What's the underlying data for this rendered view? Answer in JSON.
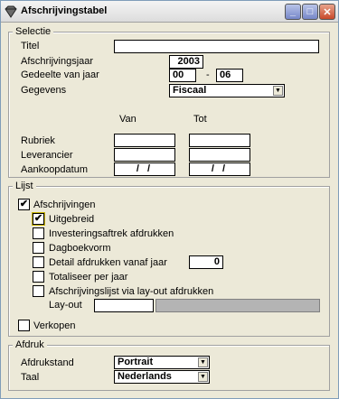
{
  "window": {
    "title": "Afschrijvingstabel",
    "buttons": {
      "minimize": "_",
      "maximize": "□",
      "close": "✕"
    }
  },
  "selectie": {
    "legend": "Selectie",
    "titel_label": "Titel",
    "titel_value": "",
    "jaar_label": "Afschrijvingsjaar",
    "jaar_value": "2003",
    "gedeelte_label": "Gedeelte van jaar",
    "gedeelte_from": "00",
    "gedeelte_sep": "-",
    "gedeelte_to": "06",
    "gegevens_label": "Gegevens",
    "gegevens_value": "Fiscaal",
    "col_van": "Van",
    "col_tot": "Tot",
    "rubriek_label": "Rubriek",
    "leverancier_label": "Leverancier",
    "aankoopdatum_label": "Aankoopdatum",
    "date_placeholder": "/ /"
  },
  "lijst": {
    "legend": "Lijst",
    "afschrijvingen": {
      "label": "Afschrijvingen",
      "checked": "✔"
    },
    "uitgebreid": {
      "label": "Uitgebreid",
      "checked": "✔"
    },
    "investeringsaftrek": {
      "label": "Investeringsaftrek afdrukken",
      "checked": ""
    },
    "dagboekvorm": {
      "label": "Dagboekvorm",
      "checked": ""
    },
    "detail": {
      "label": "Detail afdrukken vanaf jaar",
      "checked": "",
      "value": "0"
    },
    "totaliseer": {
      "label": "Totaliseer per jaar",
      "checked": ""
    },
    "layout_print": {
      "label": "Afschrijvingslijst via lay-out afdrukken",
      "checked": ""
    },
    "layout_label": "Lay-out",
    "verkopen": {
      "label": "Verkopen",
      "checked": ""
    }
  },
  "afdruk": {
    "legend": "Afdruk",
    "afdrukstand_label": "Afdrukstand",
    "afdrukstand_value": "Portrait",
    "taal_label": "Taal",
    "taal_value": "Nederlands"
  }
}
